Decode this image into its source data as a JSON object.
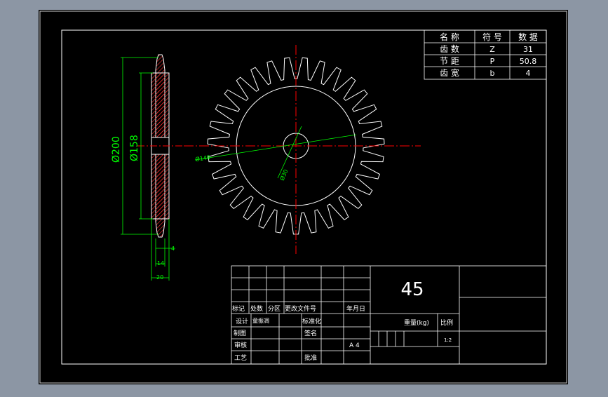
{
  "colors": {
    "background": "#8c96a4",
    "sheet": "#000000",
    "frame": "#ffffff",
    "dimension": "#00ff00",
    "centerline": "#ff0000",
    "hatch": "#ff3030"
  },
  "dimensions": {
    "tip_diameter": "Ø200",
    "root_diameter": "Ø158",
    "width_4": "4",
    "width_14": "14",
    "width_20": "20",
    "pitch_diameter": "Ø140",
    "bore_diameter": "Ø30"
  },
  "param_table": {
    "header": [
      "名 称",
      "符 号",
      "数 据"
    ],
    "rows": [
      [
        "齿 数",
        "Z",
        "31"
      ],
      [
        "节 距",
        "P",
        "50.8"
      ],
      [
        "齿 宽",
        "b",
        "4"
      ]
    ]
  },
  "title_block": {
    "material": "45",
    "rev_headers": [
      "标记",
      "处数",
      "分区",
      "更改文件号",
      "年月日"
    ],
    "design_label": "设计",
    "design_value": "童振凋",
    "standardize_label": "标准化",
    "drafting_label": "制图",
    "signature_label": "签名",
    "review_label": "审核",
    "paper_size": "A 4",
    "process_label": "工艺",
    "approve_label": "批准",
    "weight_label": "重量(kg)",
    "scale_label": "比例",
    "scale_value": "1:2"
  }
}
